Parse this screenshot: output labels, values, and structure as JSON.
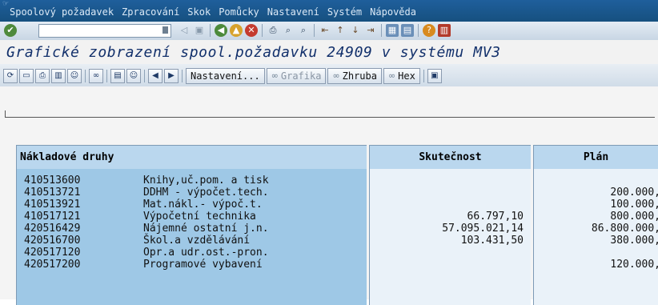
{
  "menu": [
    "Spoolový požadavek",
    "Zpracování",
    "Skok",
    "Pomůcky",
    "Nastavení",
    "Systém",
    "Nápověda"
  ],
  "title": "Grafické zobrazení spool.požadavku 24909 v systému MV3",
  "toolbar": {
    "nastaveni": "Nastavení...",
    "grafika": "Grafika",
    "zhruba": "Zhruba",
    "hex": "Hex"
  },
  "table": {
    "headers": [
      "Nákladové druhy",
      "Skutečnost",
      "Plán"
    ],
    "rows": [
      {
        "code": "410513600",
        "name": "Knihy,uč.pom. a tisk",
        "actual": "",
        "plan": ""
      },
      {
        "code": "410513721",
        "name": "DDHM - výpočet.tech.",
        "actual": "",
        "plan": "200.000,"
      },
      {
        "code": "410513921",
        "name": "Mat.nákl.- výpoč.t.",
        "actual": "",
        "plan": "100.000,"
      },
      {
        "code": "410517121",
        "name": "Výpočetní technika",
        "actual": "66.797,10",
        "plan": "800.000,"
      },
      {
        "code": "420516429",
        "name": "Nájemné ostatní j.n.",
        "actual": "57.095.021,14",
        "plan": "86.800.000,"
      },
      {
        "code": "420516700",
        "name": "Škol.a vzdělávání",
        "actual": "103.431,50",
        "plan": "380.000,"
      },
      {
        "code": "420517120",
        "name": "Opr.a udr.ost.-pron.",
        "actual": "",
        "plan": ""
      },
      {
        "code": "420517200",
        "name": "Programové vybavení",
        "actual": "",
        "plan": "120.000,"
      }
    ]
  }
}
